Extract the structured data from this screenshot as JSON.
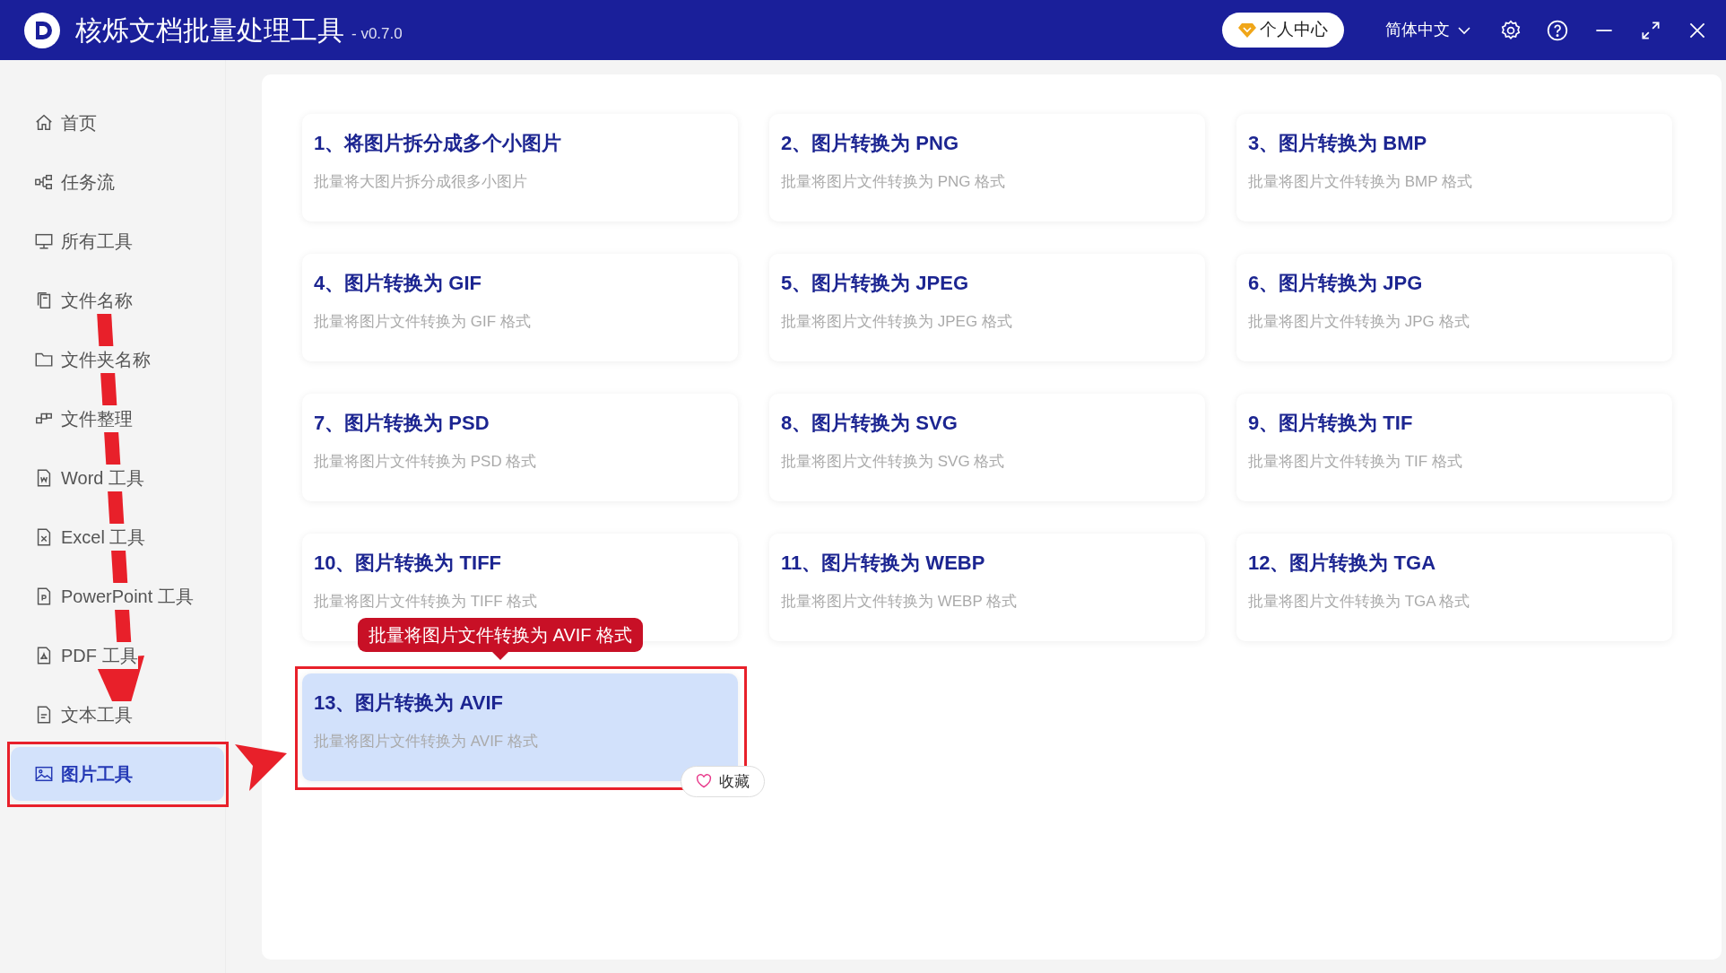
{
  "app": {
    "title": "核烁文档批量处理工具",
    "version": "- v0.7.0"
  },
  "header": {
    "account_button": "个人中心",
    "language": "简体中文"
  },
  "sidebar": {
    "items": [
      {
        "label": "首页",
        "selected": false
      },
      {
        "label": "任务流",
        "selected": false
      },
      {
        "label": "所有工具",
        "selected": false
      },
      {
        "label": "文件名称",
        "selected": false
      },
      {
        "label": "文件夹名称",
        "selected": false
      },
      {
        "label": "文件整理",
        "selected": false
      },
      {
        "label": "Word 工具",
        "selected": false
      },
      {
        "label": "Excel 工具",
        "selected": false
      },
      {
        "label": "PowerPoint 工具",
        "selected": false
      },
      {
        "label": "PDF 工具",
        "selected": false
      },
      {
        "label": "文本工具",
        "selected": false
      },
      {
        "label": "图片工具",
        "selected": true
      }
    ]
  },
  "tools": [
    {
      "title": "1、将图片拆分成多个小图片",
      "description": "批量将大图片拆分成很多小图片",
      "selected": false
    },
    {
      "title": "2、图片转换为 PNG",
      "description": "批量将图片文件转换为 PNG 格式",
      "selected": false
    },
    {
      "title": "3、图片转换为 BMP",
      "description": "批量将图片文件转换为 BMP 格式",
      "selected": false
    },
    {
      "title": "4、图片转换为 GIF",
      "description": "批量将图片文件转换为 GIF 格式",
      "selected": false
    },
    {
      "title": "5、图片转换为 JPEG",
      "description": "批量将图片文件转换为 JPEG 格式",
      "selected": false
    },
    {
      "title": "6、图片转换为 JPG",
      "description": "批量将图片文件转换为 JPG 格式",
      "selected": false
    },
    {
      "title": "7、图片转换为 PSD",
      "description": "批量将图片文件转换为 PSD 格式",
      "selected": false
    },
    {
      "title": "8、图片转换为 SVG",
      "description": "批量将图片文件转换为 SVG 格式",
      "selected": false
    },
    {
      "title": "9、图片转换为 TIF",
      "description": "批量将图片文件转换为 TIF 格式",
      "selected": false
    },
    {
      "title": "10、图片转换为 TIFF",
      "description": "批量将图片文件转换为 TIFF 格式",
      "selected": false
    },
    {
      "title": "11、图片转换为 WEBP",
      "description": "批量将图片文件转换为 WEBP 格式",
      "selected": false
    },
    {
      "title": "12、图片转换为 TGA",
      "description": "批量将图片文件转换为 TGA 格式",
      "selected": false
    },
    {
      "title": "13、图片转换为 AVIF",
      "description": "批量将图片文件转换为 AVIF 格式",
      "selected": true
    }
  ],
  "tooltip": {
    "text": "批量将图片文件转换为 AVIF 格式"
  },
  "favorite_button": {
    "label": "收藏"
  }
}
